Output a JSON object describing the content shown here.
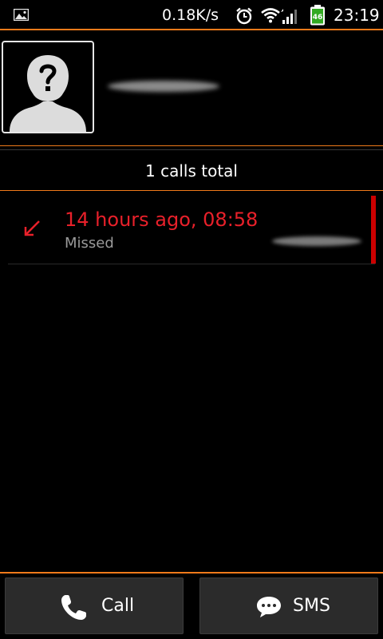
{
  "status_bar": {
    "notification_icon": "gallery-icon",
    "network_speed": "0.18K/s",
    "alarm_icon": "alarm-clock-icon",
    "wifi_icon": "wifi-icon",
    "signal_icon": "cell-signal-icon",
    "battery_icon": "battery-charging-icon",
    "battery_level": "46",
    "time": "23:19"
  },
  "contact": {
    "avatar_icon": "unknown-contact-icon"
  },
  "summary": {
    "text": "1 calls total"
  },
  "calls": [
    {
      "icon": "missed-call-icon",
      "time": "14 hours ago, 08:58",
      "type": "Missed"
    }
  ],
  "actions": {
    "call_label": "Call",
    "call_icon": "phone-icon",
    "sms_label": "SMS",
    "sms_icon": "chat-bubble-icon"
  },
  "colors": {
    "accent": "#f07a1a",
    "missed": "#e8202a",
    "missed_bar": "#cc0000",
    "secondary_text": "#9a9a9a",
    "button_bg": "#2b2b2b"
  }
}
